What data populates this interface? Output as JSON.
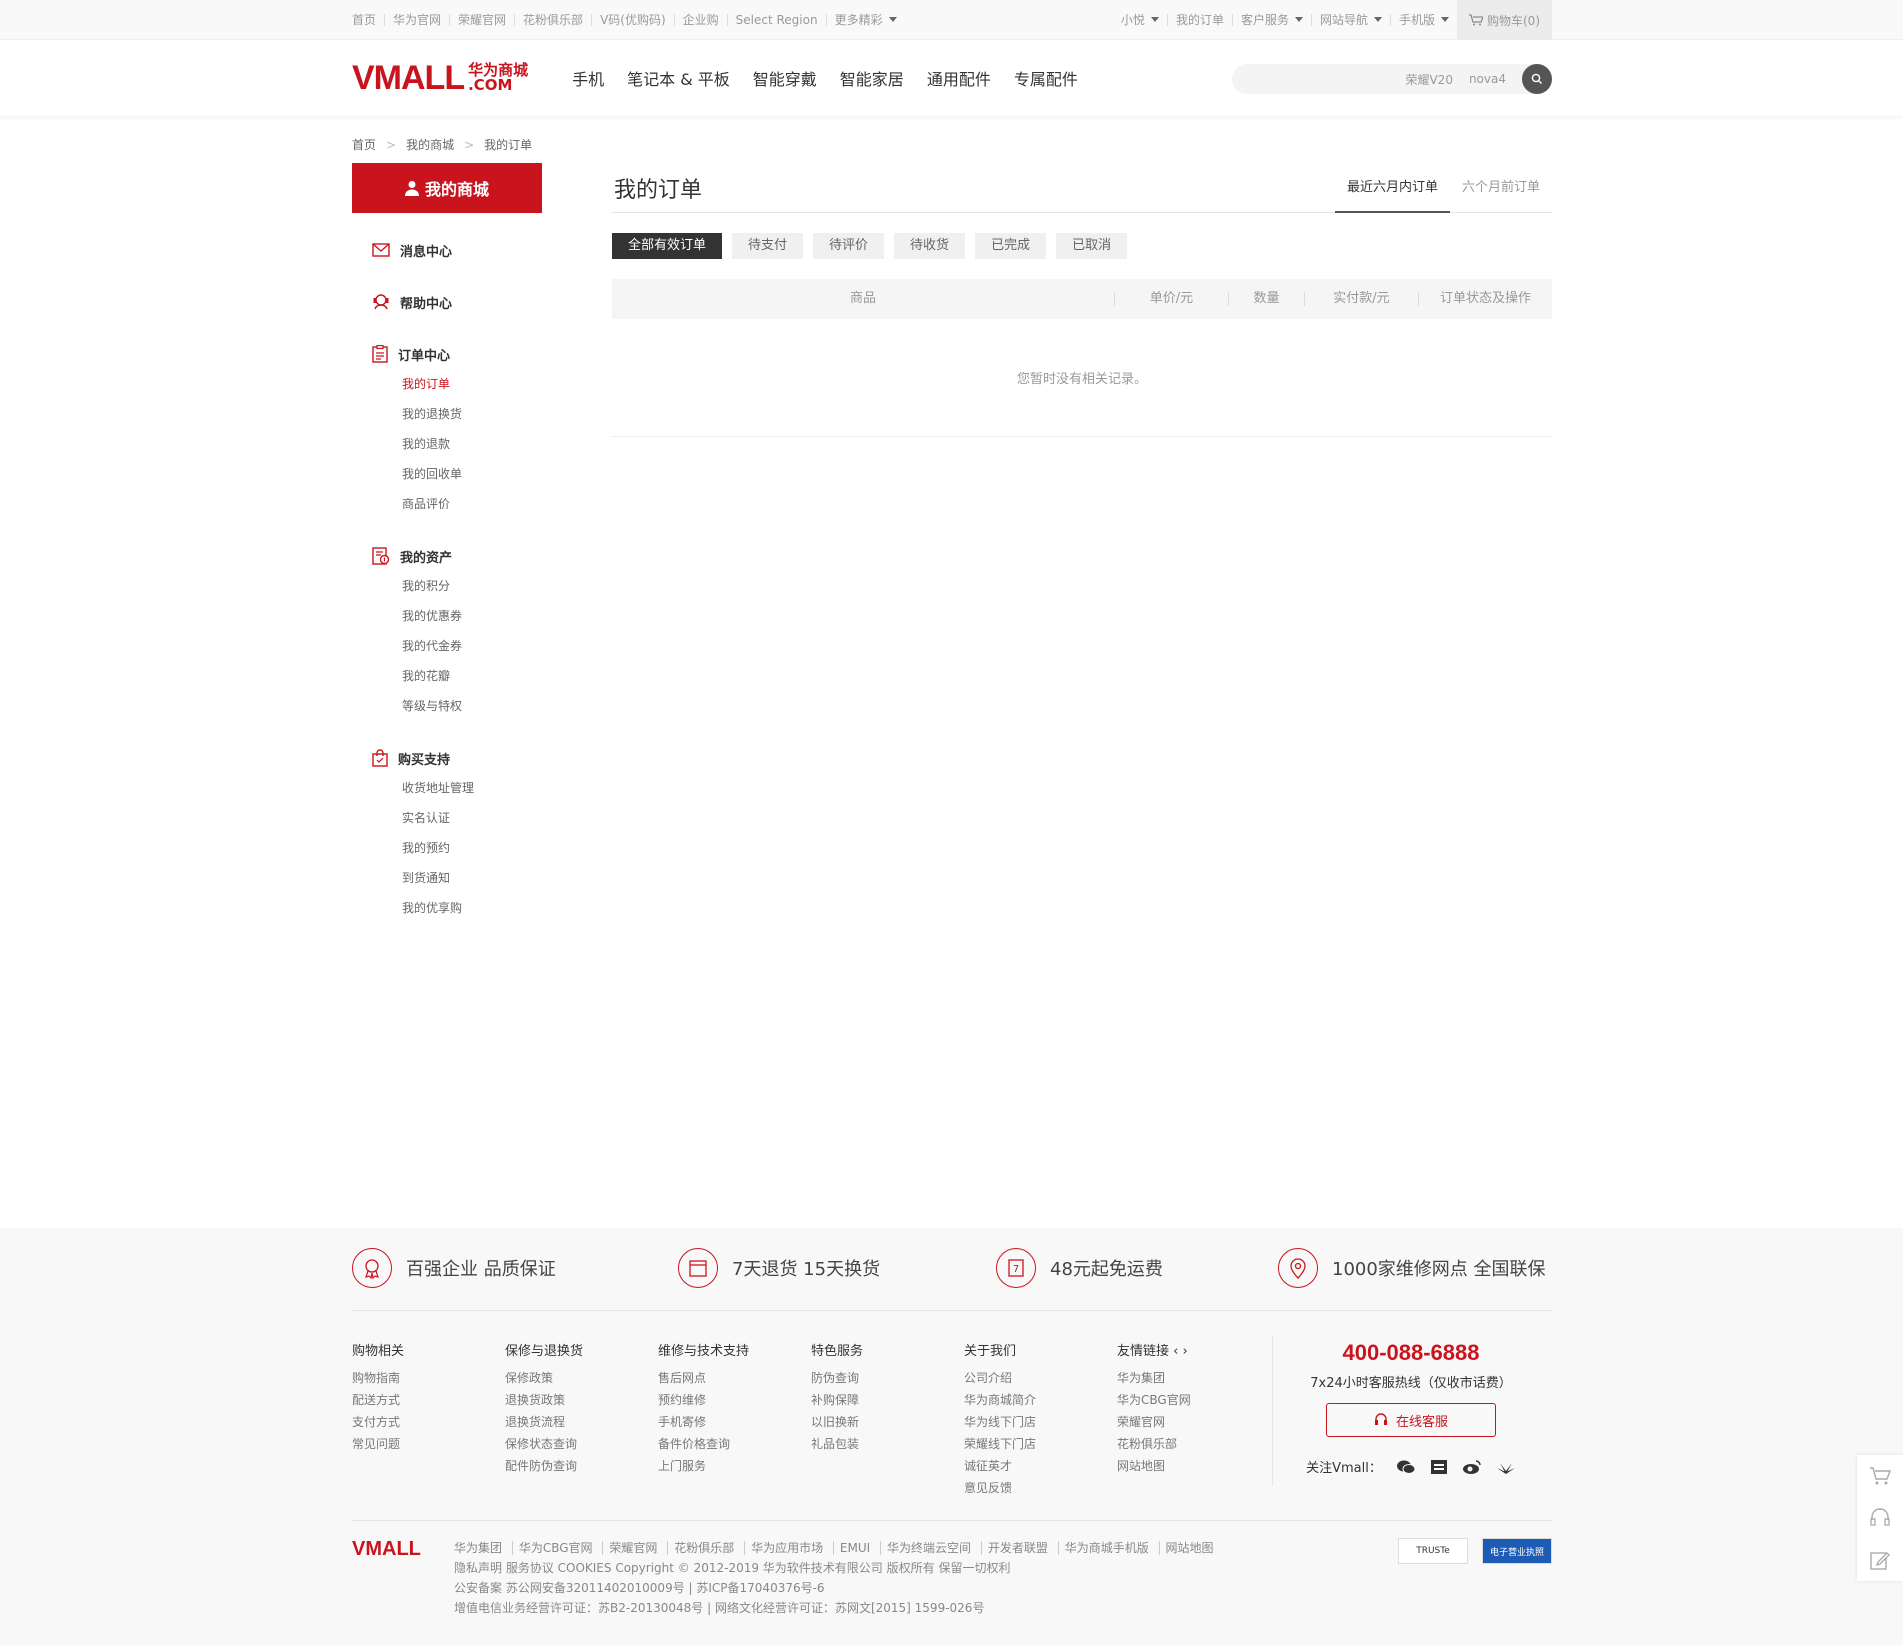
{
  "topbar": {
    "links": [
      "首页",
      "华为官网",
      "荣耀官网",
      "花粉俱乐部",
      "V码(优购码)",
      "企业购",
      "Select Region",
      "更多精彩"
    ],
    "right": [
      "小悦",
      "我的订单",
      "客户服务",
      "网站导航",
      "手机版"
    ],
    "cart": "购物车(0)"
  },
  "header": {
    "logo_main": "VMALL",
    "logo_cn": "华为商城",
    "logo_com": ".COM",
    "nav": [
      "手机",
      "笔记本 & 平板",
      "智能穿戴",
      "智能家居",
      "通用配件",
      "专属配件"
    ],
    "search_keywords": [
      "荣耀V20",
      "nova4"
    ]
  },
  "breadcrumb": [
    "首页",
    "我的商城",
    "我的订单"
  ],
  "sidebar": {
    "title": "我的商城",
    "groups": [
      {
        "title": "消息中心",
        "icon": "mail-icon",
        "items": []
      },
      {
        "title": "帮助中心",
        "icon": "help-icon",
        "items": []
      },
      {
        "title": "订单中心",
        "icon": "order-icon",
        "items": [
          "我的订单",
          "我的退换货",
          "我的退款",
          "我的回收单",
          "商品评价"
        ]
      },
      {
        "title": "我的资产",
        "icon": "assets-icon",
        "items": [
          "我的积分",
          "我的优惠券",
          "我的代金券",
          "我的花瓣",
          "等级与特权"
        ]
      },
      {
        "title": "购买支持",
        "icon": "bag-icon",
        "items": [
          "收货地址管理",
          "实名认证",
          "我的预约",
          "到货通知",
          "我的优享购"
        ]
      }
    ],
    "active_item": "我的订单"
  },
  "main": {
    "title": "我的订单",
    "period_tabs": [
      "最近六月内订单",
      "六个月前订单"
    ],
    "filters": [
      "全部有效订单",
      "待支付",
      "待评价",
      "待收货",
      "已完成",
      "已取消"
    ],
    "columns": [
      "商品",
      "单价/元",
      "数量",
      "实付款/元",
      "订单状态及操作"
    ],
    "empty_text": "您暂时没有相关记录。"
  },
  "footer": {
    "promises": [
      "百强企业 品质保证",
      "7天退货 15天换货",
      "48元起免运费",
      "1000家维修网点 全国联保"
    ],
    "columns": [
      {
        "title": "购物相关",
        "links": [
          "购物指南",
          "配送方式",
          "支付方式",
          "常见问题"
        ]
      },
      {
        "title": "保修与退换货",
        "links": [
          "保修政策",
          "退换货政策",
          "退换货流程",
          "保修状态查询",
          "配件防伪查询"
        ]
      },
      {
        "title": "维修与技术支持",
        "links": [
          "售后网点",
          "预约维修",
          "手机寄修",
          "备件价格查询",
          "上门服务"
        ]
      },
      {
        "title": "特色服务",
        "links": [
          "防伪查询",
          "补购保障",
          "以旧换新",
          "礼品包装"
        ]
      },
      {
        "title": "关于我们",
        "links": [
          "公司介绍",
          "华为商城简介",
          "华为线下门店",
          "荣耀线下门店",
          "诚征英才",
          "意见反馈"
        ]
      },
      {
        "title": "友情链接",
        "links": [
          "华为集团",
          "华为CBG官网",
          "荣耀官网",
          "花粉俱乐部",
          "网站地图"
        ]
      }
    ],
    "hotline": "400-088-6888",
    "hotline_desc": "7x24小时客服热线（仅收市话费）",
    "online_service": "在线客服",
    "follow_label": "关注Vmall：",
    "copy_logo": "VMALL",
    "copy_links": [
      "华为集团",
      "华为CBG官网",
      "荣耀官网",
      "花粉俱乐部",
      "华为应用市场",
      "EMUI",
      "华为终端云空间",
      "开发者联盟",
      "华为商城手机版",
      "网站地图"
    ],
    "copy_line2": "隐私声明  服务协议  COOKIES  Copyright © 2012-2019  华为软件技术有限公司  版权所有  保留一切权利",
    "copy_line3": "公安备案  苏公网安备32011402010009号  |  苏ICP备17040376号-6",
    "copy_line4": "增值电信业务经营许可证：苏B2-20130048号  |  网络文化经营许可证：苏网文[2015] 1599-026号",
    "badge1": "TRUSTe",
    "badge2": "电子营业执照"
  },
  "colors": {
    "brand": "#ca141d",
    "dark": "#333333"
  }
}
